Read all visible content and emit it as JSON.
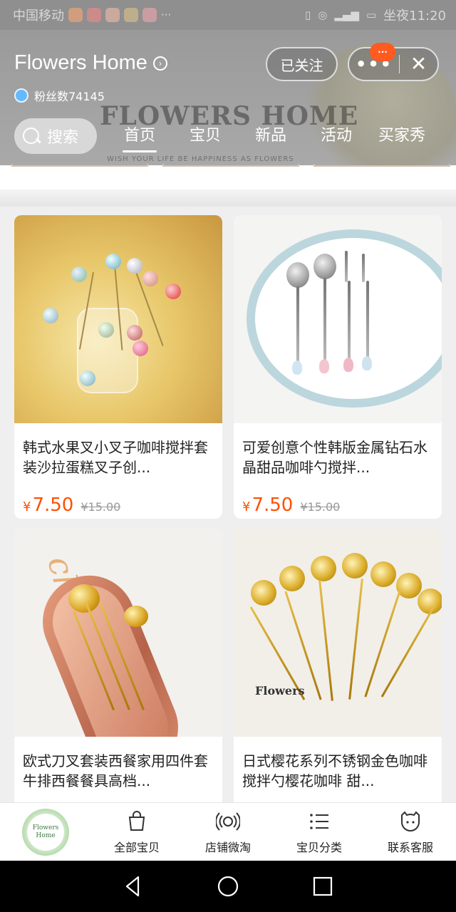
{
  "status_bar": {
    "carrier": "中国移动",
    "time": "坐夜11:20"
  },
  "store": {
    "name": "Flowers Home",
    "fans_label": "粉丝数74145",
    "follow_label": "已关注",
    "more_label": "•••",
    "notification_badge": "···",
    "close_label": "✕",
    "banner_text": "FLOWERS HOME",
    "banner_subtext": "WISH YOUR LIFE BE HAPPINESS AS FLOWERS"
  },
  "search": {
    "label": "搜索"
  },
  "tabs": [
    {
      "label": "首页",
      "active": true
    },
    {
      "label": "宝贝",
      "active": false
    },
    {
      "label": "新品",
      "active": false
    },
    {
      "label": "活动",
      "active": false
    },
    {
      "label": "买家秀",
      "active": false
    }
  ],
  "products": [
    {
      "title": "韩式水果叉小叉子咖啡搅拌套装沙拉蛋糕叉子创...",
      "currency": "¥",
      "price": "7.50",
      "original_price": "¥15.00"
    },
    {
      "title": "可爱创意个性韩版金属钻石水晶甜品咖啡勺搅拌...",
      "currency": "¥",
      "price": "7.50",
      "original_price": "¥15.00"
    },
    {
      "title": "欧式刀叉套装西餐家用四件套牛排西餐餐具高档...",
      "image_text": "charming",
      "currency": "",
      "price": "",
      "original_price": ""
    },
    {
      "title": "日式樱花系列不锈钢金色咖啡搅拌勺樱花咖啡 甜...",
      "image_text": "Flowers",
      "currency": "",
      "price": "",
      "original_price": ""
    }
  ],
  "bottom_bar": {
    "logo_text": "Flowers Home",
    "items": [
      {
        "label": "全部宝贝",
        "icon": "shopping-bag-icon"
      },
      {
        "label": "店铺微淘",
        "icon": "broadcast-icon"
      },
      {
        "label": "宝贝分类",
        "icon": "list-icon"
      },
      {
        "label": "联系客服",
        "icon": "chat-icon"
      }
    ]
  },
  "colors": {
    "price": "#ff5000",
    "badge": "#ff5a1f",
    "header_bg": "#a3a3a3"
  }
}
